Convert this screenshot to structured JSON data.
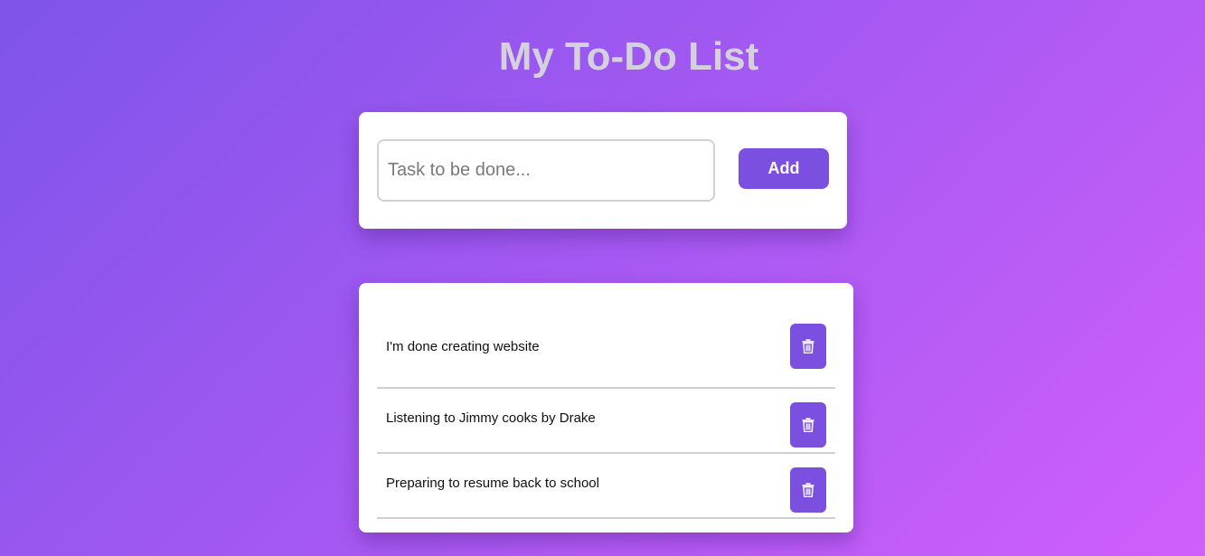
{
  "header": {
    "title": "My To-Do List"
  },
  "input_card": {
    "placeholder": "Task to be done...",
    "value": "",
    "add_label": "Add"
  },
  "tasks": [
    {
      "text": "I'm done creating website",
      "delete_icon": "trash-icon"
    },
    {
      "text": "Listening to Jimmy cooks by Drake",
      "delete_icon": "trash-icon"
    },
    {
      "text": "Preparing to resume back to school",
      "delete_icon": "trash-icon"
    }
  ],
  "colors": {
    "accent": "#7b4fe0",
    "gradient_start": "#7e54ea",
    "gradient_end": "#d05ffb",
    "title_text": "#d4d0dc"
  }
}
